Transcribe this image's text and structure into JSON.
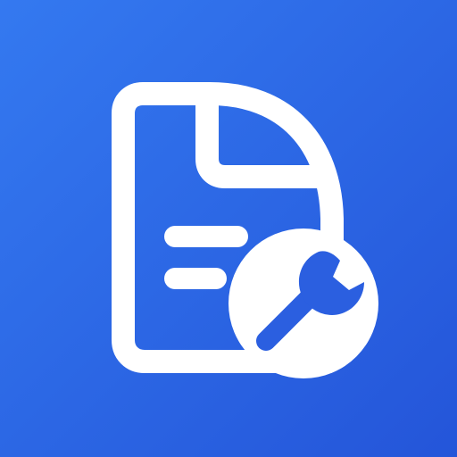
{
  "icon": {
    "name": "document-settings-icon",
    "colors": {
      "background_start": "#3479F0",
      "background_end": "#2455D9",
      "foreground": "#FFFFFF",
      "wrench": "#2B5FE0"
    }
  }
}
